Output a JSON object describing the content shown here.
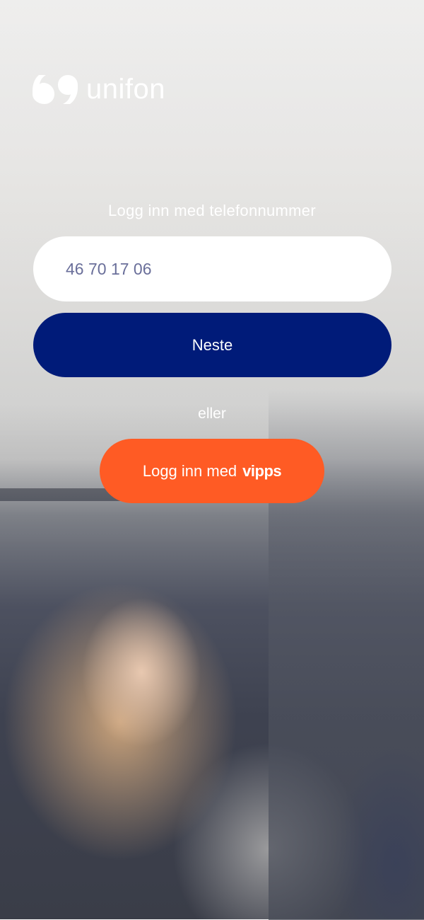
{
  "brand": {
    "name": "unifon",
    "logo_icon": "quote-marks-logo-icon"
  },
  "login": {
    "prompt": "Logg inn med telefonnummer",
    "phone_value": "46 70 17 06",
    "next_label": "Neste",
    "or_label": "eller",
    "vipps_prefix": "Logg inn med",
    "vipps_logo_text": "vipps"
  },
  "colors": {
    "primary_navy": "#001b79",
    "vipps_orange": "#ff5b24",
    "input_text": "#6a6f9a"
  }
}
